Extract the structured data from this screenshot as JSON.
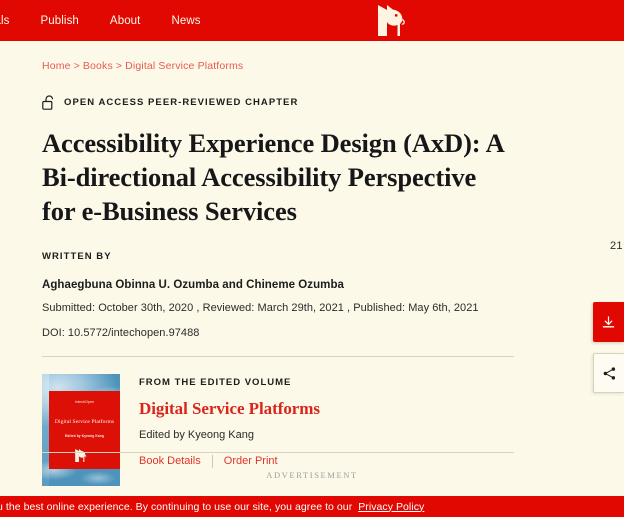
{
  "header": {
    "nav": [
      {
        "label": "nals"
      },
      {
        "label": "Publish"
      },
      {
        "label": "About"
      },
      {
        "label": "News"
      }
    ],
    "logo_name": "intechopen-logo",
    "bg_color": "#e00800"
  },
  "breadcrumb": {
    "items": [
      "Home",
      "Books",
      "Digital Service Platforms"
    ],
    "separator": ">"
  },
  "chapter": {
    "badge": "OPEN ACCESS PEER-REVIEWED CHAPTER",
    "badge_icon": "open-padlock-icon",
    "title": "Accessibility Experience Design (AxD): A Bi-directional Accessibility Perspective for e-Business Services",
    "written_by_label": "WRITTEN BY",
    "authors": "Aghaegbuna Obinna U. Ozumba and Chineme Ozumba",
    "dates": "Submitted: October 30th, 2020 , Reviewed: March 29th, 2021 , Published: May 6th, 2021",
    "doi": "DOI: 10.5772/intechopen.97488",
    "edge_counter": "21"
  },
  "volume": {
    "from_label": "FROM THE EDITED VOLUME",
    "title": "Digital Service Platforms",
    "editor": "Edited by Kyeong Kang",
    "links": [
      {
        "label": "Book Details"
      },
      {
        "label": "Order Print"
      }
    ],
    "cover": {
      "imprint": "IntechOpen",
      "title": "Digital Service Platforms",
      "editor": "Edited by Kyeong Kang"
    }
  },
  "advertisement": {
    "label": "ADVERTISEMENT"
  },
  "side_actions": [
    {
      "name": "download-button",
      "icon": "download-icon",
      "color": "#e00800"
    },
    {
      "name": "share-button",
      "icon": "share-icon",
      "color": "#fdfbf2"
    }
  ],
  "cookie_bar": {
    "text": "u the best online experience. By continuing to use our site, you agree to our",
    "link_label": "Privacy Policy",
    "bg_color": "#e00800"
  },
  "colors": {
    "brand_red": "#e00800",
    "page_bg": "#fdf9e8",
    "link_red": "#e0342b",
    "divider": "#d9d3bd"
  }
}
